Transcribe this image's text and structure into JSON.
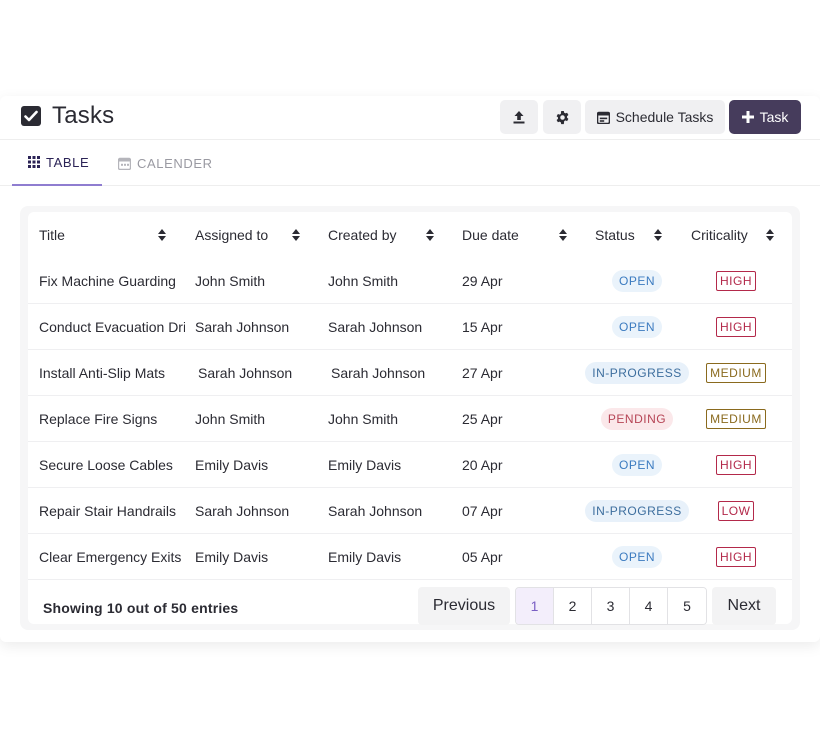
{
  "header": {
    "title": "Tasks",
    "schedule_label": "Schedule Tasks",
    "task_label": "Task"
  },
  "tabs": [
    {
      "label": "TABLE",
      "active": true
    },
    {
      "label": "CALENDER",
      "active": false
    }
  ],
  "table": {
    "columns": [
      "Title",
      "Assigned to",
      "Created by",
      "Due date",
      "Status",
      "Criticality"
    ],
    "rows": [
      {
        "title": "Fix Machine Guarding",
        "assigned": "John Smith",
        "created": "John Smith",
        "due": "29 Apr",
        "status": "OPEN",
        "criticality": "HIGH"
      },
      {
        "title": "Conduct Evacuation Drill",
        "assigned": "Sarah Johnson",
        "created": "Sarah Johnson",
        "due": "15 Apr",
        "status": "OPEN",
        "criticality": "HIGH"
      },
      {
        "title": "Install Anti-Slip Mats",
        "assigned": "Sarah Johnson",
        "created": "Sarah Johnson",
        "due": "27 Apr",
        "status": "IN-PROGRESS",
        "criticality": "MEDIUM"
      },
      {
        "title": "Replace Fire Signs",
        "assigned": "John Smith",
        "created": "John Smith",
        "due": "25 Apr",
        "status": "PENDING",
        "criticality": "MEDIUM"
      },
      {
        "title": "Secure Loose Cables",
        "assigned": "Emily Davis",
        "created": "Emily Davis",
        "due": "20 Apr",
        "status": "OPEN",
        "criticality": "HIGH"
      },
      {
        "title": "Repair Stair Handrails",
        "assigned": "Sarah Johnson",
        "created": "Sarah Johnson",
        "due": "07 Apr",
        "status": "IN-PROGRESS",
        "criticality": "LOW"
      },
      {
        "title": "Clear Emergency Exits",
        "assigned": "Emily Davis",
        "created": "Emily Davis",
        "due": "05 Apr",
        "status": "OPEN",
        "criticality": "HIGH"
      }
    ]
  },
  "footer": {
    "summary": "Showing 10 out of 50 entries",
    "previous_label": "Previous",
    "next_label": "Next",
    "pages": [
      "1",
      "2",
      "3",
      "4",
      "5"
    ],
    "current_page": "1"
  },
  "icons": {
    "page": "checkbox-checked-icon",
    "upload": "upload-icon",
    "settings": "gear-icon",
    "schedule": "calendar-icon",
    "task": "plus-icon",
    "table_tab": "grid-icon",
    "calender_tab": "calendar-icon",
    "sort": "sort-arrows-icon"
  },
  "colors": {
    "primary_button": "#463c5c",
    "active_tab_underline": "#8f7dd0",
    "status_open": "#3b7bc0",
    "status_pending": "#b64455",
    "criticality_high": "#b3294a",
    "criticality_medium": "#8a6a1e"
  }
}
